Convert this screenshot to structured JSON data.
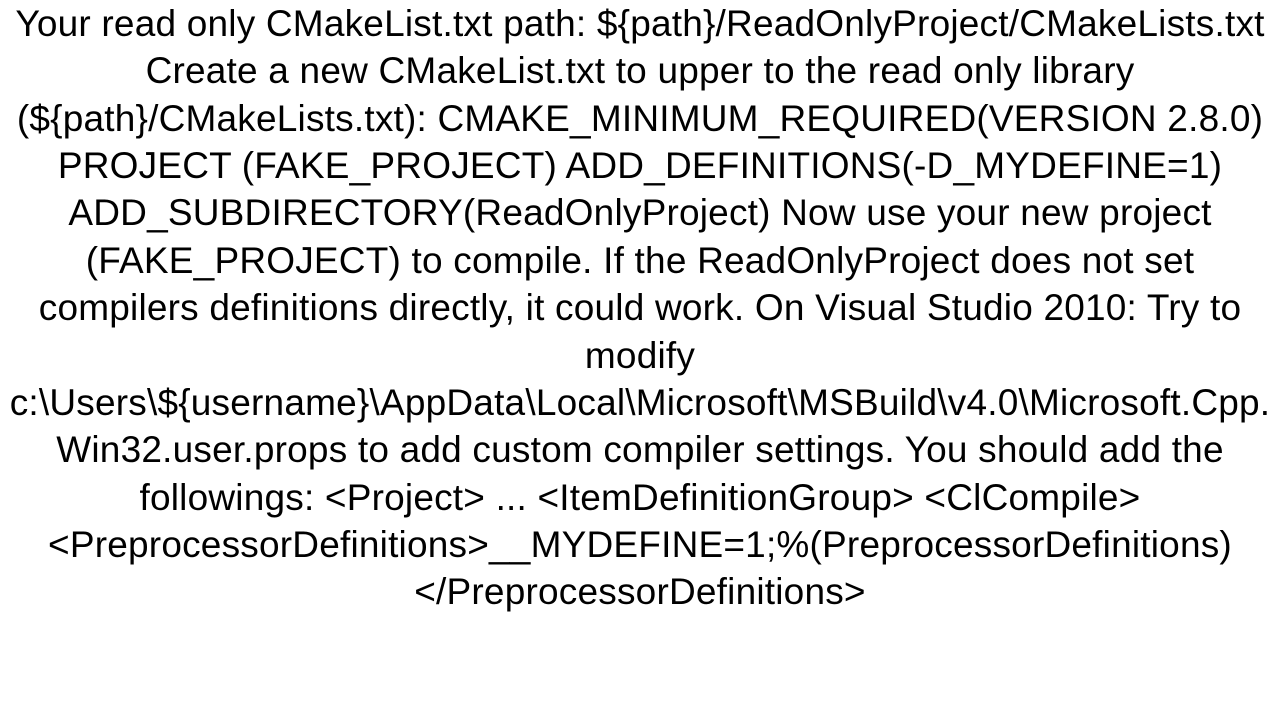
{
  "document": {
    "paragraph": "Your read only CMakeList.txt path: ${path}/ReadOnlyProject/CMakeLists.txt Create a new CMakeList.txt to upper to the read only library (${path}/CMakeLists.txt): CMAKE_MINIMUM_REQUIRED(VERSION 2.8.0) PROJECT (FAKE_PROJECT) ADD_DEFINITIONS(-D_MYDEFINE=1) ADD_SUBDIRECTORY(ReadOnlyProject)  Now use your new project (FAKE_PROJECT) to compile. If the ReadOnlyProject does not set compilers definitions directly, it could work.  On Visual Studio 2010: Try to modify c:\\Users\\${username}\\AppData\\Local\\Microsoft\\MSBuild\\v4.0\\Microsoft.Cpp.Win32.user.props to add custom compiler settings. You should add the followings: <Project>   ...   <ItemDefinitionGroup>     <ClCompile>       <PreprocessorDefinitions>__MYDEFINE=1;%(PreprocessorDefinitions)</PreprocessorDefinitions>"
  }
}
